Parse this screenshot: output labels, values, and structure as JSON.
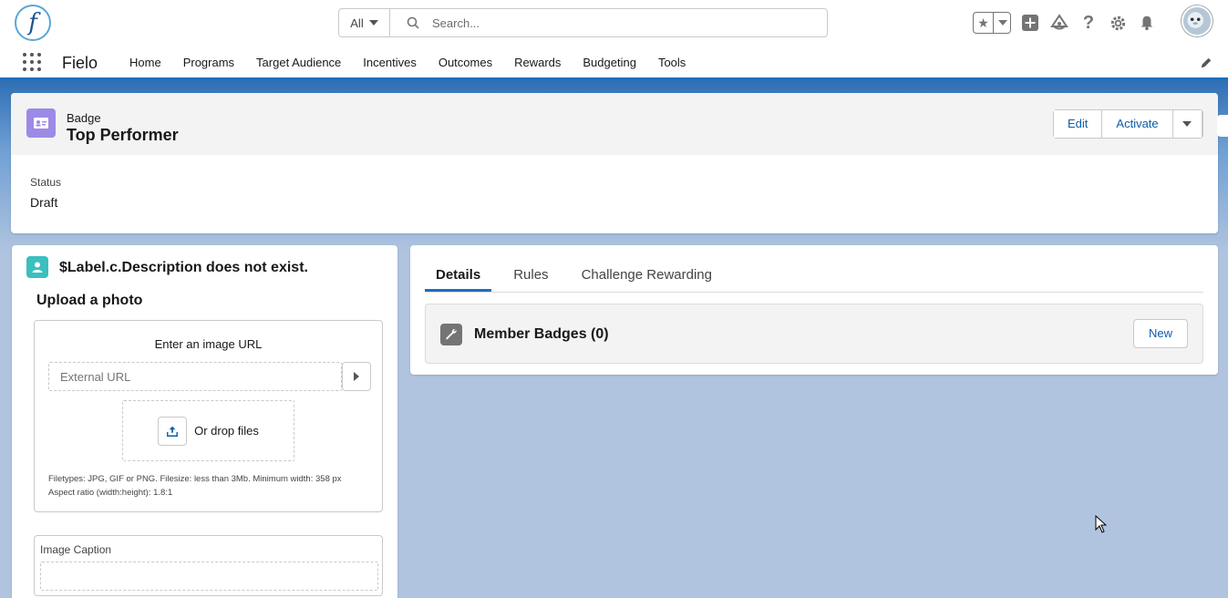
{
  "header": {
    "logo_letter": "f",
    "search_scope": "All",
    "search_placeholder": "Search..."
  },
  "nav": {
    "app_name": "Fielo",
    "items": [
      "Home",
      "Programs",
      "Target Audience",
      "Incentives",
      "Outcomes",
      "Rewards",
      "Budgeting",
      "Tools"
    ]
  },
  "record": {
    "object_type": "Badge",
    "title": "Top Performer",
    "actions": {
      "edit": "Edit",
      "activate": "Activate"
    },
    "fields": {
      "status_label": "Status",
      "status_value": "Draft"
    }
  },
  "left_card": {
    "title": "$Label.c.Description does not exist.",
    "upload_title": "Upload a photo",
    "url_label": "Enter an image URL",
    "url_placeholder": "External URL",
    "drop_text": "Or drop files",
    "help_line1": "Filetypes: JPG, GIF or PNG. Filesize: less than 3Mb. Minimum width: 358 px",
    "help_line2": "Aspect ratio (width:height): 1.8:1",
    "caption_label": "Image Caption"
  },
  "right_card": {
    "tabs": [
      "Details",
      "Rules",
      "Challenge Rewarding"
    ],
    "active_tab": "Details",
    "related_title": "Member Badges (0)",
    "new_button": "New"
  },
  "colors": {
    "brand_blue": "#1b6fc2",
    "link_blue": "#0b5cab",
    "badge_icon": "#9c8ae6",
    "contact_icon": "#3bbfbf",
    "background": "#b0c4df"
  },
  "icons": [
    "search-icon",
    "favorites-star-icon",
    "add-icon",
    "trailhead-icon",
    "help-icon",
    "setup-gear-icon",
    "notification-bell-icon",
    "waffle-icon",
    "pencil-icon",
    "badge-icon",
    "contact-icon",
    "play-icon",
    "upload-icon",
    "wrench-icon"
  ]
}
